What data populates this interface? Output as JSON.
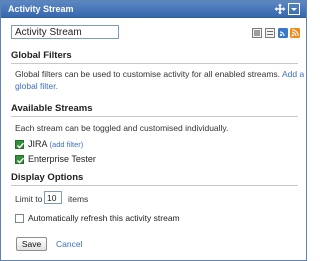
{
  "gadget": {
    "title": "Activity Stream"
  },
  "stream_name": {
    "value": "Activity Stream"
  },
  "global_filters": {
    "heading": "Global Filters",
    "description": "Global filters can be used to customise activity for all enabled streams.",
    "add_link_part1": "Add a",
    "add_link_part2": "global filter."
  },
  "available_streams": {
    "heading": "Available Streams",
    "description": "Each stream can be toggled and customised individually.",
    "items": [
      {
        "label": "JIRA",
        "link": "(add filter)",
        "checked": true
      },
      {
        "label": "Enterprise Tester",
        "checked": true
      }
    ]
  },
  "display_options": {
    "heading": "Display Options",
    "limit_prefix": "Limit to",
    "limit_value": "10",
    "limit_suffix": "items",
    "auto_refresh_label": "Automatically refresh this activity stream",
    "auto_refresh_checked": false
  },
  "actions": {
    "save_label": "Save",
    "cancel_label": "Cancel"
  },
  "icons": {
    "title_move": "move-icon",
    "title_menu": "menu-icon",
    "views": [
      "list-view-icon",
      "compact-view-icon",
      "feed-icon-blue",
      "rss-icon"
    ]
  },
  "colors": {
    "titlebar": "#3768ad",
    "link": "#3c6fc2",
    "checkbox_checked": "#2f8f3a",
    "rss": "#f28a1e"
  }
}
